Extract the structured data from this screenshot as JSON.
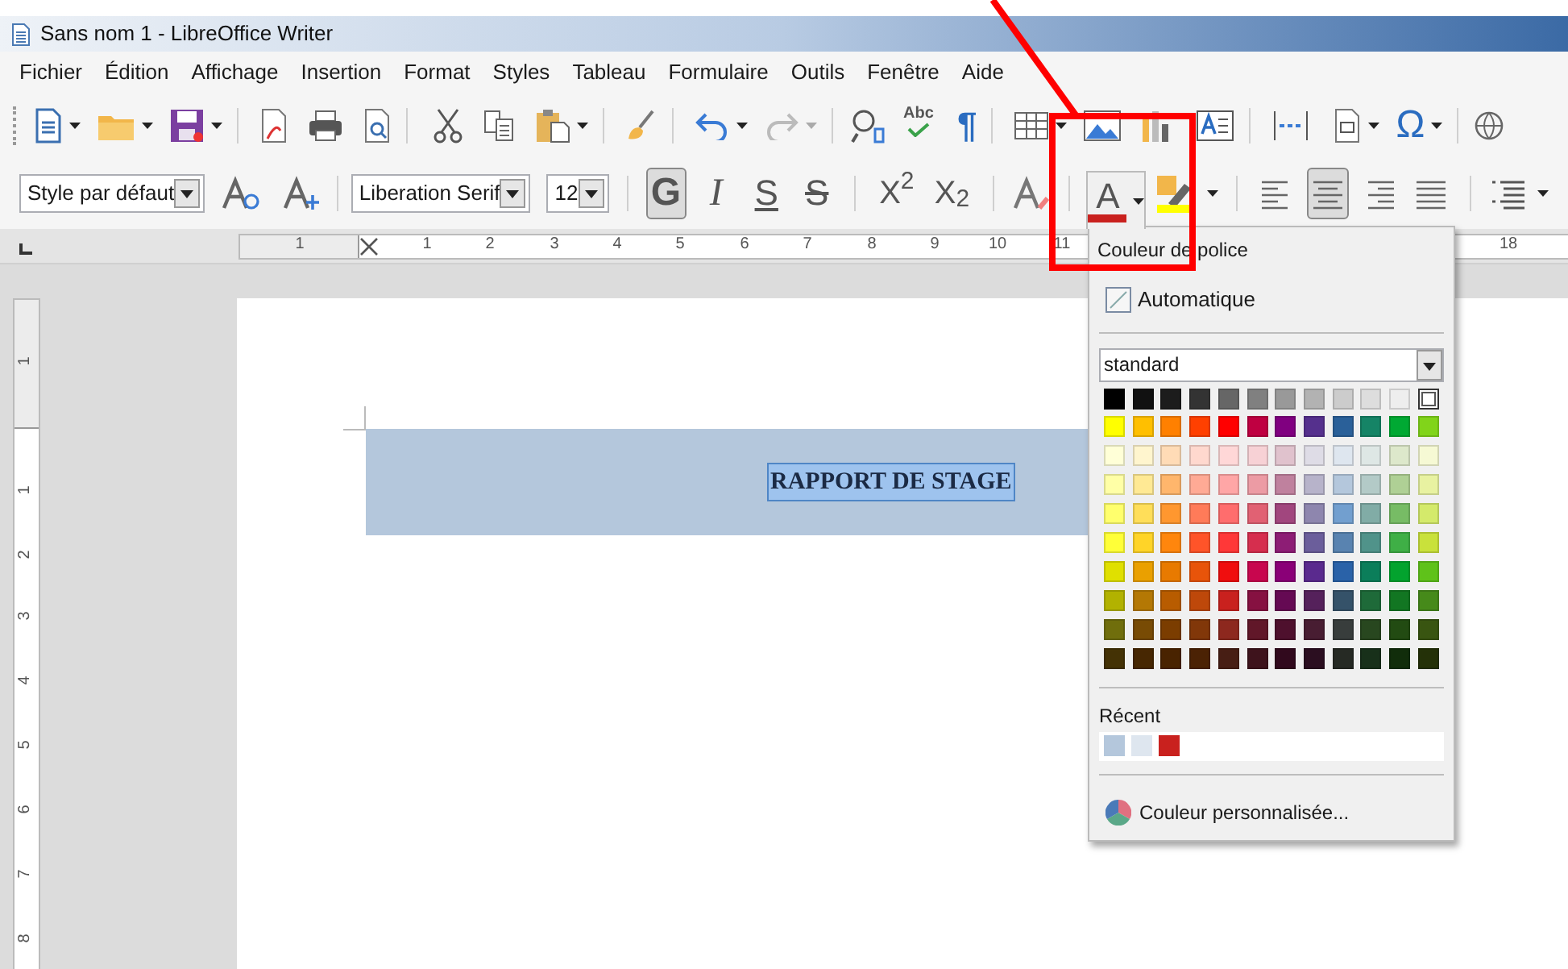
{
  "window": {
    "title": "Sans nom 1 - LibreOffice Writer"
  },
  "menu": [
    "Fichier",
    "Édition",
    "Affichage",
    "Insertion",
    "Format",
    "Styles",
    "Tableau",
    "Formulaire",
    "Outils",
    "Fenêtre",
    "Aide"
  ],
  "standard_toolbar": {
    "spellcheck": "Abc",
    "formatting_marks": "¶",
    "special_character": "Ω"
  },
  "formatting_toolbar": {
    "paragraph_style": "Style par défaut",
    "font_name": "Liberation Serif",
    "font_size": "12",
    "buttons": [
      {
        "kind": "bold",
        "label": "G",
        "on": true
      },
      {
        "kind": "italic",
        "label": "I",
        "on": false
      },
      {
        "kind": "underline",
        "label": "S",
        "on": false
      },
      {
        "kind": "strike",
        "label": "S",
        "on": false
      },
      {
        "kind": "plain",
        "label": "X$^{2}$",
        "on": false
      },
      {
        "kind": "plain",
        "label": "X$_{2}$",
        "on": false
      }
    ],
    "font_color": {
      "label": "A",
      "open": true
    },
    "alignment": [
      {
        "selected": false
      },
      {
        "selected": true
      },
      {
        "selected": false
      },
      {
        "selected": false
      }
    ]
  },
  "ruler": {
    "horizontal": [
      "1",
      "1",
      "2",
      "3",
      "4",
      "5",
      "6",
      "7",
      "8",
      "9",
      "10",
      "11",
      "18"
    ],
    "vertical": [
      "1",
      "1",
      "2",
      "3",
      "4",
      "5",
      "6",
      "7",
      "8"
    ]
  },
  "document": {
    "heading": "RAPPORT DE STAGE",
    "heading_selected": true
  },
  "font_color_popup": {
    "title": "Couleur de police",
    "automatic": "Automatique",
    "palette": "standard",
    "swatches": [
      [
        {
          "color": "#000000",
          "selected": false
        },
        {
          "color": "#111111",
          "selected": false
        },
        {
          "color": "#1c1c1c",
          "selected": false
        },
        {
          "color": "#333333",
          "selected": false
        },
        {
          "color": "#666666",
          "selected": false
        },
        {
          "color": "#808080",
          "selected": false
        },
        {
          "color": "#999999",
          "selected": false
        },
        {
          "color": "#b2b2b2",
          "selected": false
        },
        {
          "color": "#cccccc",
          "selected": false
        },
        {
          "color": "#dddddd",
          "selected": false
        },
        {
          "color": "#eeeeee",
          "selected": false
        },
        {
          "color": "#ffffff",
          "selected": true
        }
      ],
      [
        {
          "color": "#ffff00",
          "selected": false
        },
        {
          "color": "#ffbf00",
          "selected": false
        },
        {
          "color": "#ff8000",
          "selected": false
        },
        {
          "color": "#ff4000",
          "selected": false
        },
        {
          "color": "#ff0000",
          "selected": false
        },
        {
          "color": "#bf0041",
          "selected": false
        },
        {
          "color": "#800080",
          "selected": false
        },
        {
          "color": "#55308d",
          "selected": false
        },
        {
          "color": "#2a6099",
          "selected": false
        },
        {
          "color": "#158466",
          "selected": false
        },
        {
          "color": "#00a933",
          "selected": false
        },
        {
          "color": "#81d41a",
          "selected": false
        }
      ],
      [
        {
          "color": "#ffffd7",
          "selected": false
        },
        {
          "color": "#fff5ce",
          "selected": false
        },
        {
          "color": "#ffdbb6",
          "selected": false
        },
        {
          "color": "#ffd8ce",
          "selected": false
        },
        {
          "color": "#ffd7d7",
          "selected": false
        },
        {
          "color": "#f7d1d5",
          "selected": false
        },
        {
          "color": "#e0c2cd",
          "selected": false
        },
        {
          "color": "#dedce6",
          "selected": false
        },
        {
          "color": "#dee6ef",
          "selected": false
        },
        {
          "color": "#dee7e5",
          "selected": false
        },
        {
          "color": "#dde8cb",
          "selected": false
        },
        {
          "color": "#f6f9d4",
          "selected": false
        }
      ],
      [
        {
          "color": "#ffffa6",
          "selected": false
        },
        {
          "color": "#ffe994",
          "selected": false
        },
        {
          "color": "#ffb66c",
          "selected": false
        },
        {
          "color": "#ffaa95",
          "selected": false
        },
        {
          "color": "#ffa6a6",
          "selected": false
        },
        {
          "color": "#ec9ba4",
          "selected": false
        },
        {
          "color": "#bf819e",
          "selected": false
        },
        {
          "color": "#b7b3ca",
          "selected": false
        },
        {
          "color": "#b4c7dc",
          "selected": false
        },
        {
          "color": "#b3cac7",
          "selected": false
        },
        {
          "color": "#afd095",
          "selected": false
        },
        {
          "color": "#e8f2a1",
          "selected": false
        }
      ],
      [
        {
          "color": "#ffff6d",
          "selected": false
        },
        {
          "color": "#ffde59",
          "selected": false
        },
        {
          "color": "#ff972f",
          "selected": false
        },
        {
          "color": "#ff7b59",
          "selected": false
        },
        {
          "color": "#ff6d6d",
          "selected": false
        },
        {
          "color": "#e16173",
          "selected": false
        },
        {
          "color": "#a1467e",
          "selected": false
        },
        {
          "color": "#8e86ae",
          "selected": false
        },
        {
          "color": "#729fcf",
          "selected": false
        },
        {
          "color": "#81aca6",
          "selected": false
        },
        {
          "color": "#77bc65",
          "selected": false
        },
        {
          "color": "#d4ea6b",
          "selected": false
        }
      ],
      [
        {
          "color": "#ffff38",
          "selected": false
        },
        {
          "color": "#ffd428",
          "selected": false
        },
        {
          "color": "#ff860d",
          "selected": false
        },
        {
          "color": "#ff5429",
          "selected": false
        },
        {
          "color": "#ff3838",
          "selected": false
        },
        {
          "color": "#d62e4e",
          "selected": false
        },
        {
          "color": "#8d1d75",
          "selected": false
        },
        {
          "color": "#6b5e9b",
          "selected": false
        },
        {
          "color": "#5983b0",
          "selected": false
        },
        {
          "color": "#50938a",
          "selected": false
        },
        {
          "color": "#3faf46",
          "selected": false
        },
        {
          "color": "#c9e13b",
          "selected": false
        }
      ],
      [
        {
          "color": "#e0e000",
          "selected": false
        },
        {
          "color": "#eaa000",
          "selected": false
        },
        {
          "color": "#e87a00",
          "selected": false
        },
        {
          "color": "#e8540a",
          "selected": false
        },
        {
          "color": "#f00e0e",
          "selected": false
        },
        {
          "color": "#c8064e",
          "selected": false
        },
        {
          "color": "#8a0077",
          "selected": false
        },
        {
          "color": "#5a2a8e",
          "selected": false
        },
        {
          "color": "#2a62a8",
          "selected": false
        },
        {
          "color": "#0b7e5a",
          "selected": false
        },
        {
          "color": "#03a32e",
          "selected": false
        },
        {
          "color": "#5fc21a",
          "selected": false
        }
      ],
      [
        {
          "color": "#b2b200",
          "selected": false
        },
        {
          "color": "#b47804",
          "selected": false
        },
        {
          "color": "#b85c00",
          "selected": false
        },
        {
          "color": "#be480a",
          "selected": false
        },
        {
          "color": "#c9211e",
          "selected": false
        },
        {
          "color": "#861141",
          "selected": false
        },
        {
          "color": "#650953",
          "selected": false
        },
        {
          "color": "#55215b",
          "selected": false
        },
        {
          "color": "#355269",
          "selected": false
        },
        {
          "color": "#1e6a39",
          "selected": false
        },
        {
          "color": "#127622",
          "selected": false
        },
        {
          "color": "#468a1a",
          "selected": false
        }
      ],
      [
        {
          "color": "#706e0c",
          "selected": false
        },
        {
          "color": "#784b04",
          "selected": false
        },
        {
          "color": "#7b3d00",
          "selected": false
        },
        {
          "color": "#813709",
          "selected": false
        },
        {
          "color": "#8d281e",
          "selected": false
        },
        {
          "color": "#611729",
          "selected": false
        },
        {
          "color": "#4e102d",
          "selected": false
        },
        {
          "color": "#481d32",
          "selected": false
        },
        {
          "color": "#383d3c",
          "selected": false
        },
        {
          "color": "#28471f",
          "selected": false
        },
        {
          "color": "#224b12",
          "selected": false
        },
        {
          "color": "#395511",
          "selected": false
        }
      ],
      [
        {
          "color": "#443205",
          "selected": false
        },
        {
          "color": "#472702",
          "selected": false
        },
        {
          "color": "#492300",
          "selected": false
        },
        {
          "color": "#4b2204",
          "selected": false
        },
        {
          "color": "#471e14",
          "selected": false
        },
        {
          "color": "#3e131c",
          "selected": false
        },
        {
          "color": "#31091d",
          "selected": false
        },
        {
          "color": "#2b0e20",
          "selected": false
        },
        {
          "color": "#262a24",
          "selected": false
        },
        {
          "color": "#18301a",
          "selected": false
        },
        {
          "color": "#112d0b",
          "selected": false
        },
        {
          "color": "#243108",
          "selected": false
        }
      ]
    ],
    "recent_label": "Récent",
    "recent": [
      {
        "color": "#b4c7dc"
      },
      {
        "color": "#dee6ef"
      },
      {
        "color": "#c9211e"
      }
    ],
    "custom": "Couleur personnalisée..."
  }
}
